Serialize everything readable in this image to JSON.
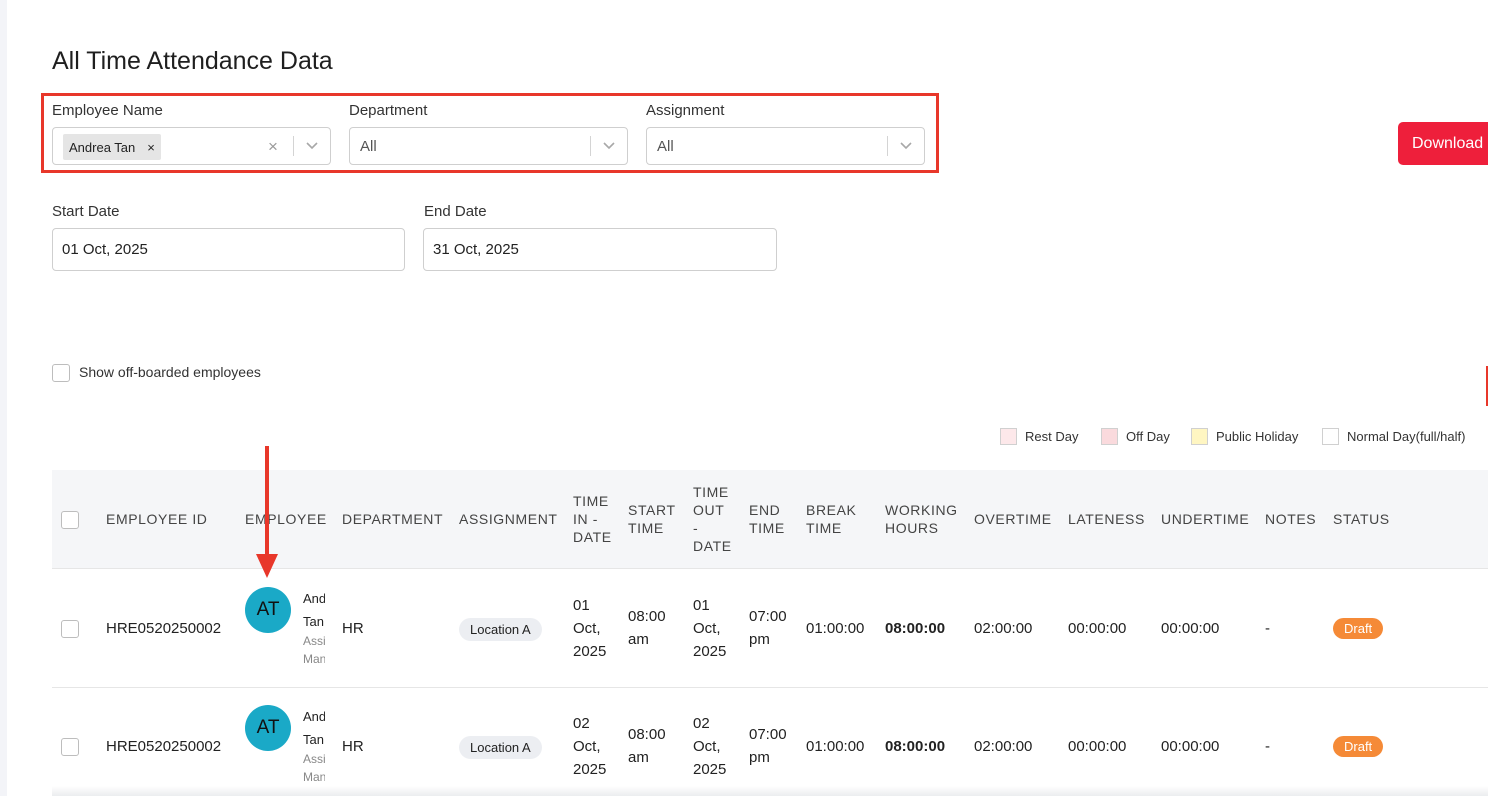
{
  "page": {
    "title": "All Time Attendance Data"
  },
  "filters": {
    "employee_name": {
      "label": "Employee Name",
      "selected_chip": "Andrea Tan",
      "chip_remove": "×",
      "clear": "×"
    },
    "department": {
      "label": "Department",
      "value": "All"
    },
    "assignment": {
      "label": "Assignment",
      "value": "All"
    }
  },
  "download_button": {
    "label": "Download"
  },
  "dates": {
    "start": {
      "label": "Start Date",
      "value": "01 Oct, 2025"
    },
    "end": {
      "label": "End Date",
      "value": "31 Oct, 2025"
    }
  },
  "offboarded": {
    "label": "Show off-boarded employees",
    "checked": false
  },
  "legend": [
    {
      "label": "Rest Day",
      "color": "#fde8ea"
    },
    {
      "label": "Off Day",
      "color": "#fadadd"
    },
    {
      "label": "Public Holiday",
      "color": "#fff6c2"
    },
    {
      "label": "Normal Day(full/half)",
      "color": "#ffffff"
    }
  ],
  "table": {
    "headers": {
      "employee_id": "EMPLOYEE ID",
      "employee": "EMPLOYEE",
      "department": "DEPARTMENT",
      "assignment": "ASSIGNMENT",
      "time_in_date": [
        "TIME",
        "IN -",
        "DATE"
      ],
      "start_time": [
        "START",
        "TIME"
      ],
      "time_out_date": [
        "TIME",
        "OUT",
        "-",
        "DATE"
      ],
      "end_time": [
        "END",
        "TIME"
      ],
      "break_time": [
        "BREAK",
        "TIME"
      ],
      "working_hours": [
        "WORKING",
        "HOURS"
      ],
      "overtime": "OVERTIME",
      "lateness": "LATENESS",
      "undertime": "UNDERTIME",
      "notes": "NOTES",
      "status": "STATUS"
    },
    "rows": [
      {
        "employee_id": "HRE0520250002",
        "initials": "AT",
        "name_line1": "Andrea",
        "name_line2": "Tan",
        "role_line1": "Assistant",
        "role_line2": "Manager",
        "department": "HR",
        "assignment": "Location A",
        "time_in_date": [
          "01",
          "Oct,",
          "2025"
        ],
        "start_time": [
          "08:00",
          "am"
        ],
        "time_out_date": [
          "01",
          "Oct,",
          "2025"
        ],
        "end_time": [
          "07:00",
          "pm"
        ],
        "break_time": "01:00:00",
        "working_hours": "08:00:00",
        "overtime": "02:00:00",
        "lateness": "00:00:00",
        "undertime": "00:00:00",
        "notes": "-",
        "status": "Draft"
      },
      {
        "employee_id": "HRE0520250002",
        "initials": "AT",
        "name_line1": "Andrea",
        "name_line2": "Tan",
        "role_line1": "Assistant",
        "role_line2": "Manager",
        "department": "HR",
        "assignment": "Location A",
        "time_in_date": [
          "02",
          "Oct,",
          "2025"
        ],
        "start_time": [
          "08:00",
          "am"
        ],
        "time_out_date": [
          "02",
          "Oct,",
          "2025"
        ],
        "end_time": [
          "07:00",
          "pm"
        ],
        "break_time": "01:00:00",
        "working_hours": "08:00:00",
        "overtime": "02:00:00",
        "lateness": "00:00:00",
        "undertime": "00:00:00",
        "notes": "-",
        "status": "Draft"
      }
    ]
  },
  "colors": {
    "accent_red": "#ee1f3b",
    "highlight_red": "#e8372a",
    "avatar": "#1aa9c7",
    "draft_orange": "#f58a37"
  }
}
